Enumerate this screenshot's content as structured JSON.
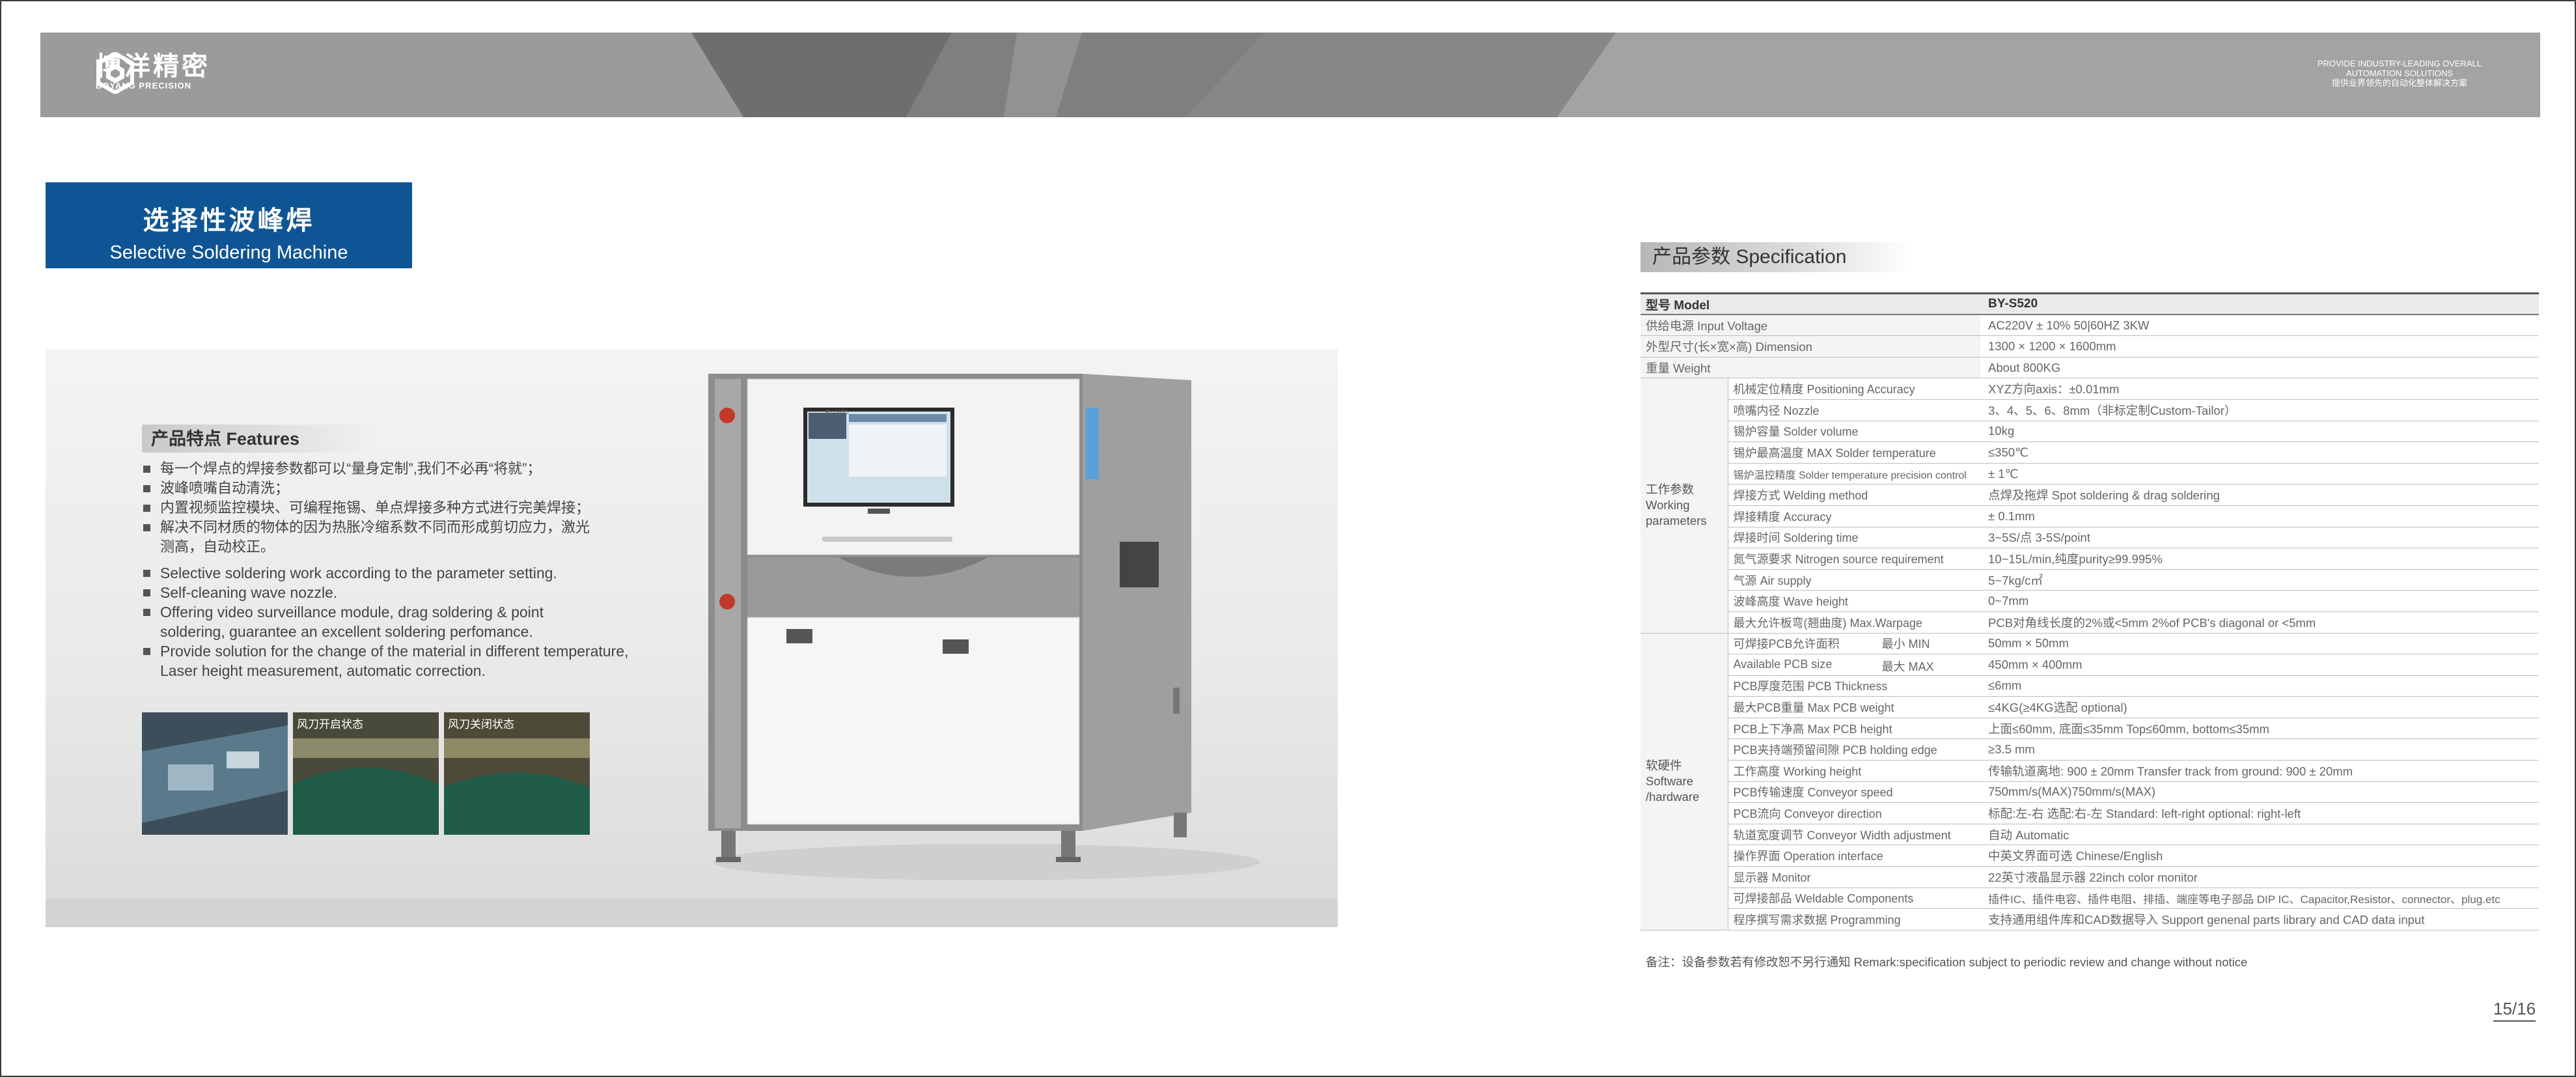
{
  "brand": {
    "name_cn": "博洋精密",
    "name_en": "BOYANG PRECISION",
    "slogan_en_1": "PROVIDE INDUSTRY-LEADING OVERALL",
    "slogan_en_2": "AUTOMATION SOLUTIONS",
    "slogan_cn": "提供业界领先的自动化整体解决方案"
  },
  "title": {
    "cn": "选择性波峰焊",
    "en": "Selective Soldering Machine"
  },
  "features": {
    "heading": "产品特点 Features",
    "items_cn": [
      "每一个焊点的焊接参数都可以“量身定制”,我们不必再“将就”；",
      "波峰喷嘴自动清洗；",
      "内置视频监控模块、可编程拖锡、单点焊接多种方式进行完美焊接；",
      "解决不同材质的物体的因为热胀冷缩系数不同而形成剪切应力，激光测高，自动校正。"
    ],
    "items_en": [
      "Selective soldering work according to the parameter setting.",
      "Self-cleaning wave nozzle.",
      "Offering video surveillance module, drag soldering & point soldering, guarantee  an excellent soldering perfomance.",
      "Provide solution for the change of the material in different temperature, Laser height measurement, automatic correction."
    ]
  },
  "thumbnails": [
    {
      "caption": ""
    },
    {
      "caption": "风刀开启状态"
    },
    {
      "caption": "风刀关闭状态"
    }
  ],
  "machine": {
    "badge": "BY-S520"
  },
  "spec": {
    "heading": "产品参数 Specification",
    "model_label": "型号 Model",
    "model_value": "BY-S520",
    "general": [
      {
        "label": "供给电源 Input Voltage",
        "value": "AC220V ± 10% 50|60HZ 3KW"
      },
      {
        "label": "外型尺寸(长×宽×高) Dimension",
        "value": "1300 × 1200 × 1600mm"
      },
      {
        "label": "重量 Weight",
        "value": "About 800KG"
      }
    ],
    "working_group": "工作参数 Working parameters",
    "working": [
      {
        "label": "机械定位精度 Positioning Accuracy",
        "value": "XYZ方向axis：±0.01mm"
      },
      {
        "label": "喷嘴内径 Nozzle",
        "value": "3、4、5、6、8mm（非标定制Custom-Tailor）"
      },
      {
        "label": "锡炉容量 Solder volume",
        "value": "10kg"
      },
      {
        "label": "锡炉最高温度 MAX Solder temperature",
        "value": "≤350℃"
      },
      {
        "label": "锡炉温控精度 Solder temperature precision control",
        "value": "± 1℃"
      },
      {
        "label": "焊接方式 Welding method",
        "value": "点焊及拖焊 Spot soldering & drag soldering"
      },
      {
        "label": "焊接精度 Accuracy",
        "value": "± 0.1mm"
      },
      {
        "label": "焊接时间 Soldering time",
        "value": "3~5S/点 3-5S/point"
      },
      {
        "label": "氮气源要求 Nitrogen source requirement",
        "value": "10~15L/min,纯度purity≥99.995%"
      },
      {
        "label": "气源 Air supply",
        "value": "5~7kg/c㎡"
      },
      {
        "label": "波峰高度 Wave height",
        "value": "0~7mm"
      },
      {
        "label": "最大允许板弯(翘曲度) Max.Warpage",
        "value": "PCB对角线长度的2%或<5mm  2%of PCB's diagonal or <5mm"
      }
    ],
    "hardware_group": "软硬件 Software /hardware",
    "pcb_size_label_1": "可焊接PCB允许面积",
    "pcb_size_label_2": "Available  PCB size",
    "pcb_min_label": "最小 MIN",
    "pcb_min_value": "50mm × 50mm",
    "pcb_max_label": "最大 MAX",
    "pcb_max_value": "450mm × 400mm",
    "hardware": [
      {
        "label": "PCB厚度范围 PCB Thickness",
        "value": "≤6mm"
      },
      {
        "label": "最大PCB重量 Max PCB weight",
        "value": "≤4KG(≥4KG选配 optional)"
      },
      {
        "label": "PCB上下净高 Max PCB height",
        "value": "上面≤60mm, 底面≤35mm   Top≤60mm, bottom≤35mm"
      },
      {
        "label": "PCB夹持端预留间隙 PCB holding edge",
        "value": "≥3.5 mm"
      },
      {
        "label": "工作高度 Working height",
        "value": "传输轨道离地: 900 ± 20mm  Transfer track from ground: 900 ± 20mm"
      },
      {
        "label": "PCB传输速度 Conveyor speed",
        "value": "750mm/s(MAX)750mm/s(MAX)"
      },
      {
        "label": "PCB流向 Conveyor  direction",
        "value": "标配:左-右  选配:右-左    Standard: left-right  optional: right-left"
      },
      {
        "label": "轨道宽度调节 Conveyor Width adjustment",
        "value": "自动 Automatic"
      },
      {
        "label": "操作界面 Operation interface",
        "value": "中英文界面可选 Chinese/English"
      },
      {
        "label": "显示器 Monitor",
        "value": "22英寸液晶显示器 22inch color monitor"
      },
      {
        "label": "可焊接部品 Weldable Components",
        "value": "插件IC、插件电容、插件电阻、排插、端座等电子部品 DIP IC、Capacitor,Resistor、connector、plug.etc"
      },
      {
        "label": "程序撰写需求数据 Programming",
        "value": "支持通用组件库和CAD数据导入 Support genenal parts library and CAD data input"
      }
    ],
    "remark": "备注：设备参数若有修改恕不另行通知 Remark:specification subject to  periodic review and change without notice"
  },
  "page_number": "15/16"
}
